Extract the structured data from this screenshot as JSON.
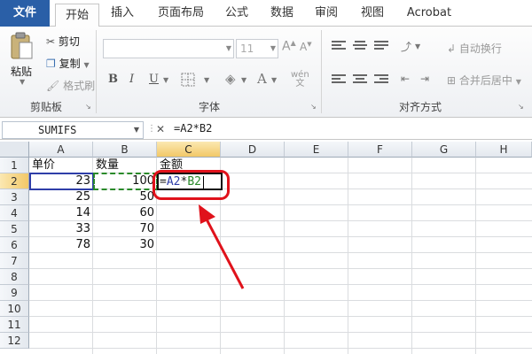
{
  "tabs": [
    "文件",
    "开始",
    "插入",
    "页面布局",
    "公式",
    "数据",
    "审阅",
    "视图",
    "Acrobat"
  ],
  "ribbon": {
    "clipboard": {
      "paste": "粘贴",
      "cut": "剪切",
      "copy": "复制",
      "format_painter": "格式刷",
      "label": "剪贴板"
    },
    "font": {
      "size": "11",
      "bold": "B",
      "italic": "I",
      "underline": "U",
      "font_color": "A",
      "label": "字体"
    },
    "alignment": {
      "wrap": "自动换行",
      "merge": "合并后居中",
      "label": "对齐方式"
    }
  },
  "formula_bar": {
    "name_box": "SUMIFS",
    "cancel": "✕",
    "enter": "✓",
    "fx": "fx",
    "formula": "=A2*B2"
  },
  "columns": [
    "A",
    "B",
    "C",
    "D",
    "E",
    "F",
    "G",
    "H"
  ],
  "rows": [
    "1",
    "2",
    "3",
    "4",
    "5",
    "6",
    "7",
    "8",
    "9",
    "10",
    "11",
    "12"
  ],
  "headers": {
    "a1": "单价",
    "b1": "数量",
    "c1": "金额"
  },
  "data_rows": [
    {
      "a": "23",
      "b": "100"
    },
    {
      "a": "25",
      "b": "50"
    },
    {
      "a": "14",
      "b": "60"
    },
    {
      "a": "33",
      "b": "70"
    },
    {
      "a": "78",
      "b": "30"
    }
  ],
  "edit_cell": {
    "ref_a": "A2",
    "op": "*",
    "ref_b": "B2",
    "prefix": "="
  },
  "colors": {
    "accent": "#2a5fa7",
    "highlight": "#e0121b",
    "ref_a": "#2f3ea8",
    "ref_b": "#2a8a2a"
  }
}
